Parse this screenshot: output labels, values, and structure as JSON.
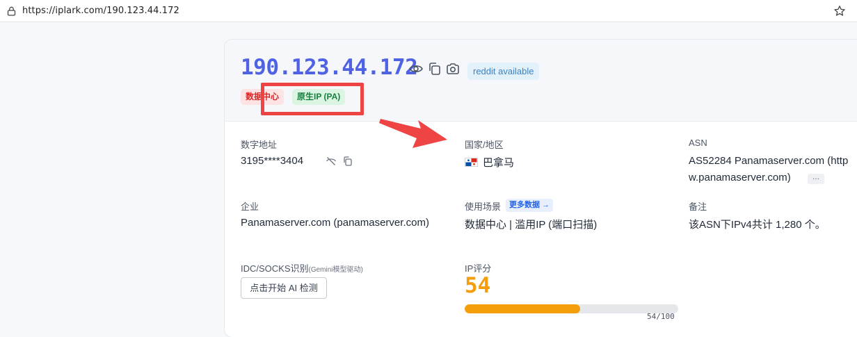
{
  "browser": {
    "url": "https://iplark.com/190.123.44.172"
  },
  "header": {
    "ip": "190.123.44.172",
    "reddit_badge": "reddit available",
    "tags": [
      "数据中心",
      "原生IP (PA)"
    ]
  },
  "fields": {
    "numeric_address": {
      "label": "数字地址",
      "value": "3195****3404"
    },
    "country": {
      "label": "国家/地区",
      "value": "巴拿马",
      "flag": "panama-flag"
    },
    "asn": {
      "label": "ASN",
      "line1": "AS52284 Panamaserver.com (http",
      "line2": "w.panamaserver.com)",
      "more": "..."
    },
    "company": {
      "label": "企业",
      "value": "Panamaserver.com (panamaserver.com)"
    },
    "usage": {
      "label": "使用场景",
      "more_label": "更多数据 →",
      "value": "数据中心 | 滥用IP (端口扫描)"
    },
    "remark": {
      "label": "备注",
      "value": "该ASN下IPv4共计 1,280 个。"
    },
    "idc": {
      "label": "IDC/SOCKS识别",
      "note": "(Gemini模型驱动)",
      "button": "点击开始 AI 检测"
    },
    "score": {
      "label": "IP评分",
      "value": "54",
      "max_text": "54/100",
      "fraction": 0.54
    }
  },
  "colors": {
    "ip_title": "#4f62e3",
    "score": "#f59e0b",
    "highlight": "#ef4444"
  },
  "icons": [
    "lock-icon",
    "star-icon",
    "eye-icon",
    "copy-icon",
    "camera-icon",
    "eye-off-icon",
    "copy-icon"
  ]
}
